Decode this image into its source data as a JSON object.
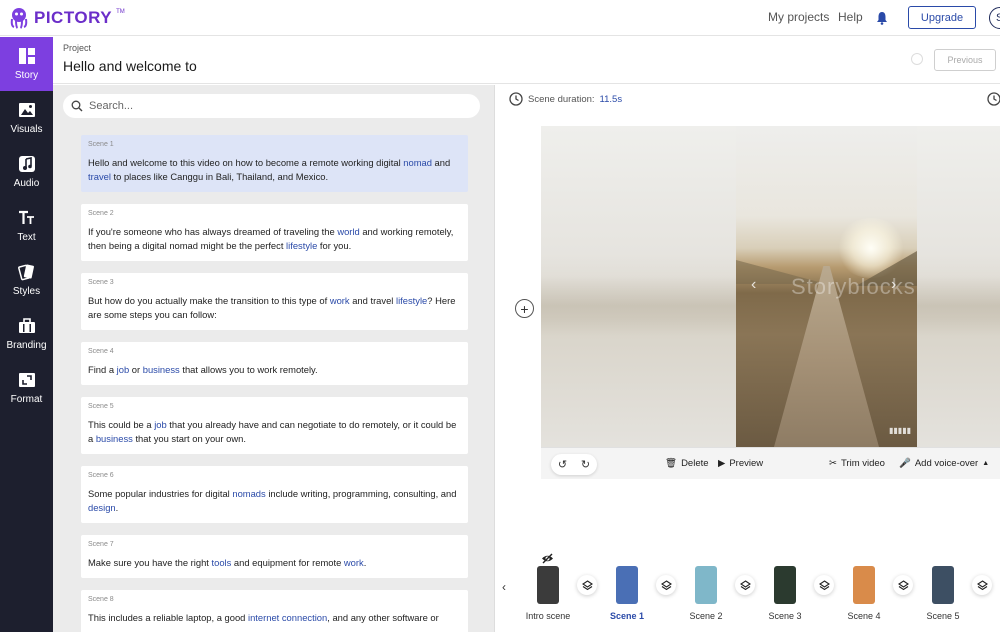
{
  "app": {
    "brand": "PICTORY",
    "tm": "TM"
  },
  "topnav": {
    "my_projects": "My projects",
    "help": "Help",
    "upgrade": "Upgrade",
    "avatar_initial": "S"
  },
  "sidebar": {
    "items": [
      {
        "label": "Story",
        "icon": "story-icon",
        "active": true
      },
      {
        "label": "Visuals",
        "icon": "image-icon"
      },
      {
        "label": "Audio",
        "icon": "music-icon"
      },
      {
        "label": "Text",
        "icon": "text-icon"
      },
      {
        "label": "Styles",
        "icon": "styles-icon"
      },
      {
        "label": "Branding",
        "icon": "briefcase-icon"
      },
      {
        "label": "Format",
        "icon": "format-icon"
      }
    ]
  },
  "project": {
    "label": "Project",
    "title": "Hello and welcome to",
    "previous": "Previous"
  },
  "search": {
    "placeholder": "Search..."
  },
  "scenes": [
    {
      "num": "Scene 1",
      "parts": [
        "Hello and welcome to this video on how to become a remote working digital ",
        "nomad",
        " and ",
        "travel",
        " to places like Canggu in Bali, Thailand, and Mexico."
      ]
    },
    {
      "num": "Scene 2",
      "parts": [
        "If you're someone who has always dreamed of traveling the ",
        "world",
        " and working remotely, then being a digital nomad might be the perfect ",
        "lifestyle",
        " for you."
      ]
    },
    {
      "num": "Scene 3",
      "parts": [
        "But how do you actually make the transition to this type of ",
        "work",
        " and travel ",
        "lifestyle",
        "? Here are some steps you can follow:"
      ]
    },
    {
      "num": "Scene 4",
      "parts": [
        "Find a ",
        "job",
        " or ",
        "business",
        " that allows you to work remotely."
      ]
    },
    {
      "num": "Scene 5",
      "parts": [
        "This could be a ",
        "job",
        " that you already have and can negotiate to do remotely, or it could be a ",
        "business",
        " that you start on your own."
      ]
    },
    {
      "num": "Scene 6",
      "parts": [
        "Some popular industries for digital ",
        "nomads",
        " include writing, programming, consulting, and ",
        "design",
        "."
      ]
    },
    {
      "num": "Scene 7",
      "parts": [
        "Make sure you have the right ",
        "tools",
        " and equipment for remote ",
        "work",
        "."
      ]
    },
    {
      "num": "Scene 8",
      "parts": [
        "This includes a reliable laptop, a good ",
        "internet connection",
        ", and any other software or"
      ]
    }
  ],
  "preview": {
    "duration_label": "Scene duration:",
    "duration_value": "11.5s",
    "watermark": "Storyblocks",
    "delete": "Delete",
    "preview": "Preview",
    "trim": "Trim video",
    "voiceover": "Add voice-over"
  },
  "strip": {
    "items": [
      {
        "label": "Intro scene",
        "color": "#3b3b3b"
      },
      {
        "label": "Scene 1",
        "color": "#4a6fb5",
        "active": true
      },
      {
        "label": "Scene 2",
        "color": "#7fb7c9"
      },
      {
        "label": "Scene 3",
        "color": "#2b3a2f"
      },
      {
        "label": "Scene 4",
        "color": "#d98b4a"
      },
      {
        "label": "Scene 5",
        "color": "#3d4f63"
      }
    ]
  },
  "colors": {
    "accent": "#7d3fe0",
    "link": "#2a4aa8",
    "sidebar": "#1d1f2e"
  }
}
